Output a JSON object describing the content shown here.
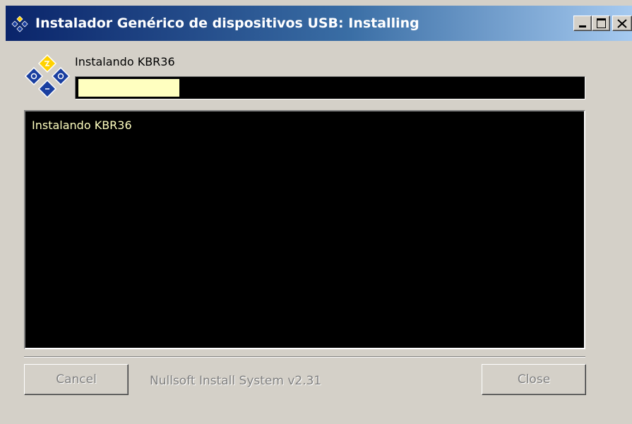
{
  "window": {
    "title": "Instalador Genérico de dispositivos USB: Installing",
    "title_icon": "installer-diamonds-icon",
    "controls": {
      "minimize_icon": "minimize-icon",
      "maximize_icon": "maximize-icon",
      "close_icon": "close-icon"
    }
  },
  "header": {
    "icon": "installer-diamonds-icon",
    "status_text": "Instalando KBR36",
    "progress": {
      "percent": 20,
      "fill_color": "#ffffc0",
      "track_color": "#000000"
    }
  },
  "log": {
    "text_color": "#ffffc0",
    "background": "#000000",
    "lines": [
      "Instalando KBR36"
    ]
  },
  "footer": {
    "cancel_label": "Cancel",
    "cancel_enabled": false,
    "branding": "Nullsoft Install System v2.31",
    "close_label": "Close",
    "close_enabled": false
  },
  "colors": {
    "titlebar_start": "#0a246a",
    "titlebar_end": "#a6caf0",
    "dialog_face": "#d4d0c8"
  }
}
